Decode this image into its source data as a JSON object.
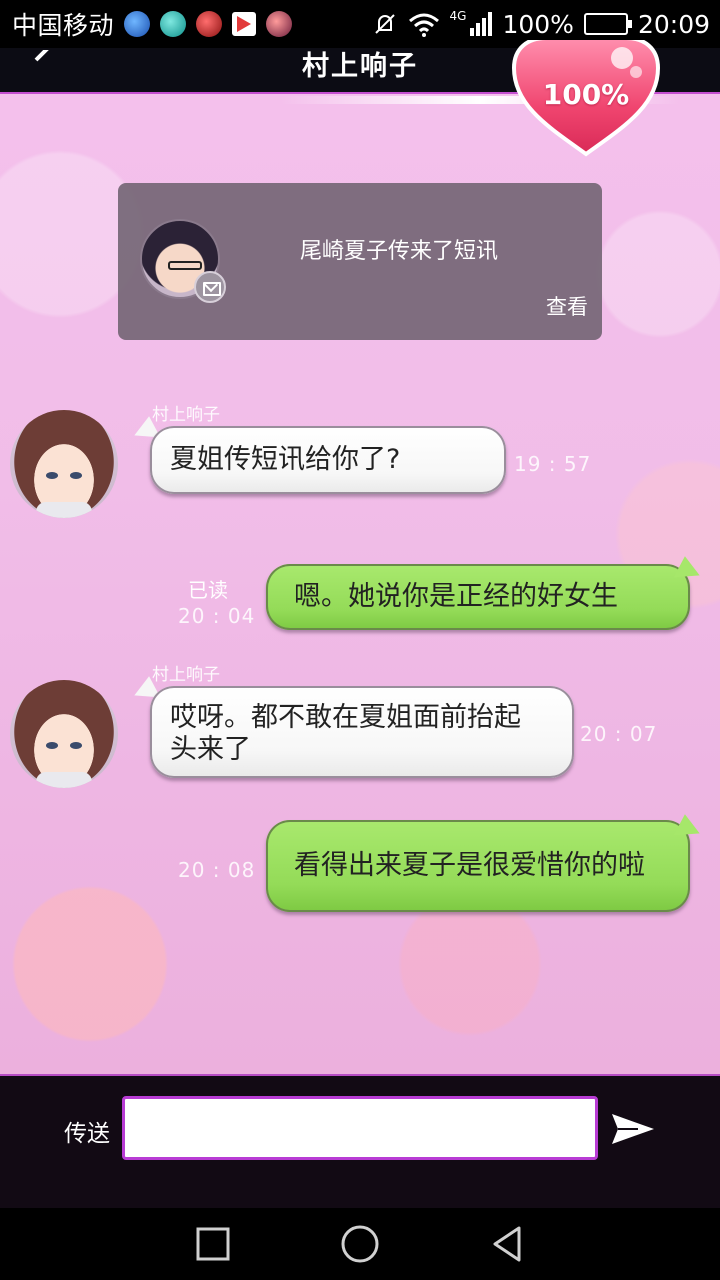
{
  "status_bar": {
    "carrier": "中国移动",
    "network": "4G",
    "battery": "100%",
    "time": "20:09"
  },
  "header": {
    "title": "村上响子",
    "affection": "100%"
  },
  "notification": {
    "text": "尾崎夏子传来了短讯",
    "view_label": "查看"
  },
  "messages": [
    {
      "sender": "村上响子",
      "text": "夏姐传短讯给你了?",
      "time": "19 : 57"
    },
    {
      "status": "已读",
      "text": "嗯。她说你是正经的好女生",
      "time": "20 : 04"
    },
    {
      "sender": "村上响子",
      "text": "哎呀。都不敢在夏姐面前抬起头来了",
      "time": "20 : 07"
    },
    {
      "text": "看得出来夏子是很爱惜你的啦",
      "time": "20 : 08"
    }
  ],
  "input_bar": {
    "label": "传送",
    "value": ""
  },
  "colors": {
    "accent": "#b83cd4",
    "outgoing_bubble": "#94db58",
    "incoming_bubble": "#ffffff",
    "heart": "#f0456f"
  }
}
